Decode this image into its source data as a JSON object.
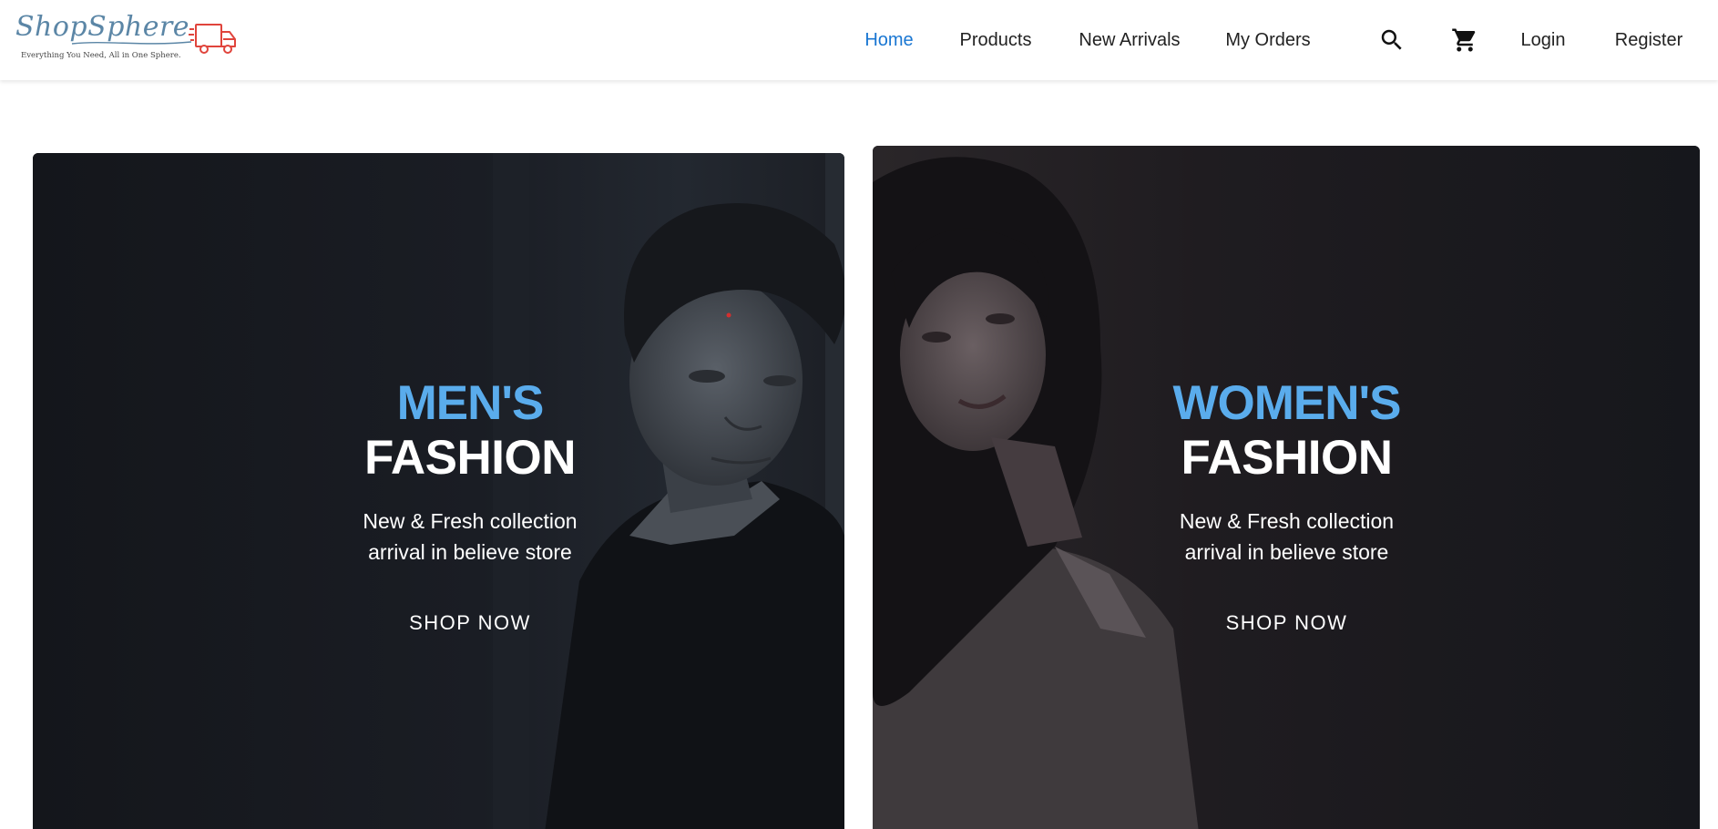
{
  "brand": {
    "name": "ShopSphere",
    "tagline": "Everything You Need, All in One Sphere."
  },
  "nav": {
    "links": [
      {
        "label": "Home",
        "active": true
      },
      {
        "label": "Products",
        "active": false
      },
      {
        "label": "New Arrivals",
        "active": false
      },
      {
        "label": "My Orders",
        "active": false
      }
    ],
    "login_label": "Login",
    "register_label": "Register",
    "icons": [
      "search-icon",
      "cart-icon",
      "delivery-truck-icon"
    ]
  },
  "banners": {
    "men": {
      "headline_accent": "MEN'S",
      "headline_main": "FASHION",
      "subtitle_line1": "New & Fresh collection",
      "subtitle_line2": "arrival in believe store",
      "cta": "SHOP NOW"
    },
    "women": {
      "headline_accent": "WOMEN'S",
      "headline_main": "FASHION",
      "subtitle_line1": "New & Fresh collection",
      "subtitle_line2": "arrival in believe store",
      "cta": "SHOP NOW"
    }
  },
  "colors": {
    "accent_blue": "#5aacec",
    "nav_active": "#1976d2",
    "banner_dark": "#17181d",
    "logo_blue": "#5b86a6",
    "truck_red": "#e0443c"
  }
}
